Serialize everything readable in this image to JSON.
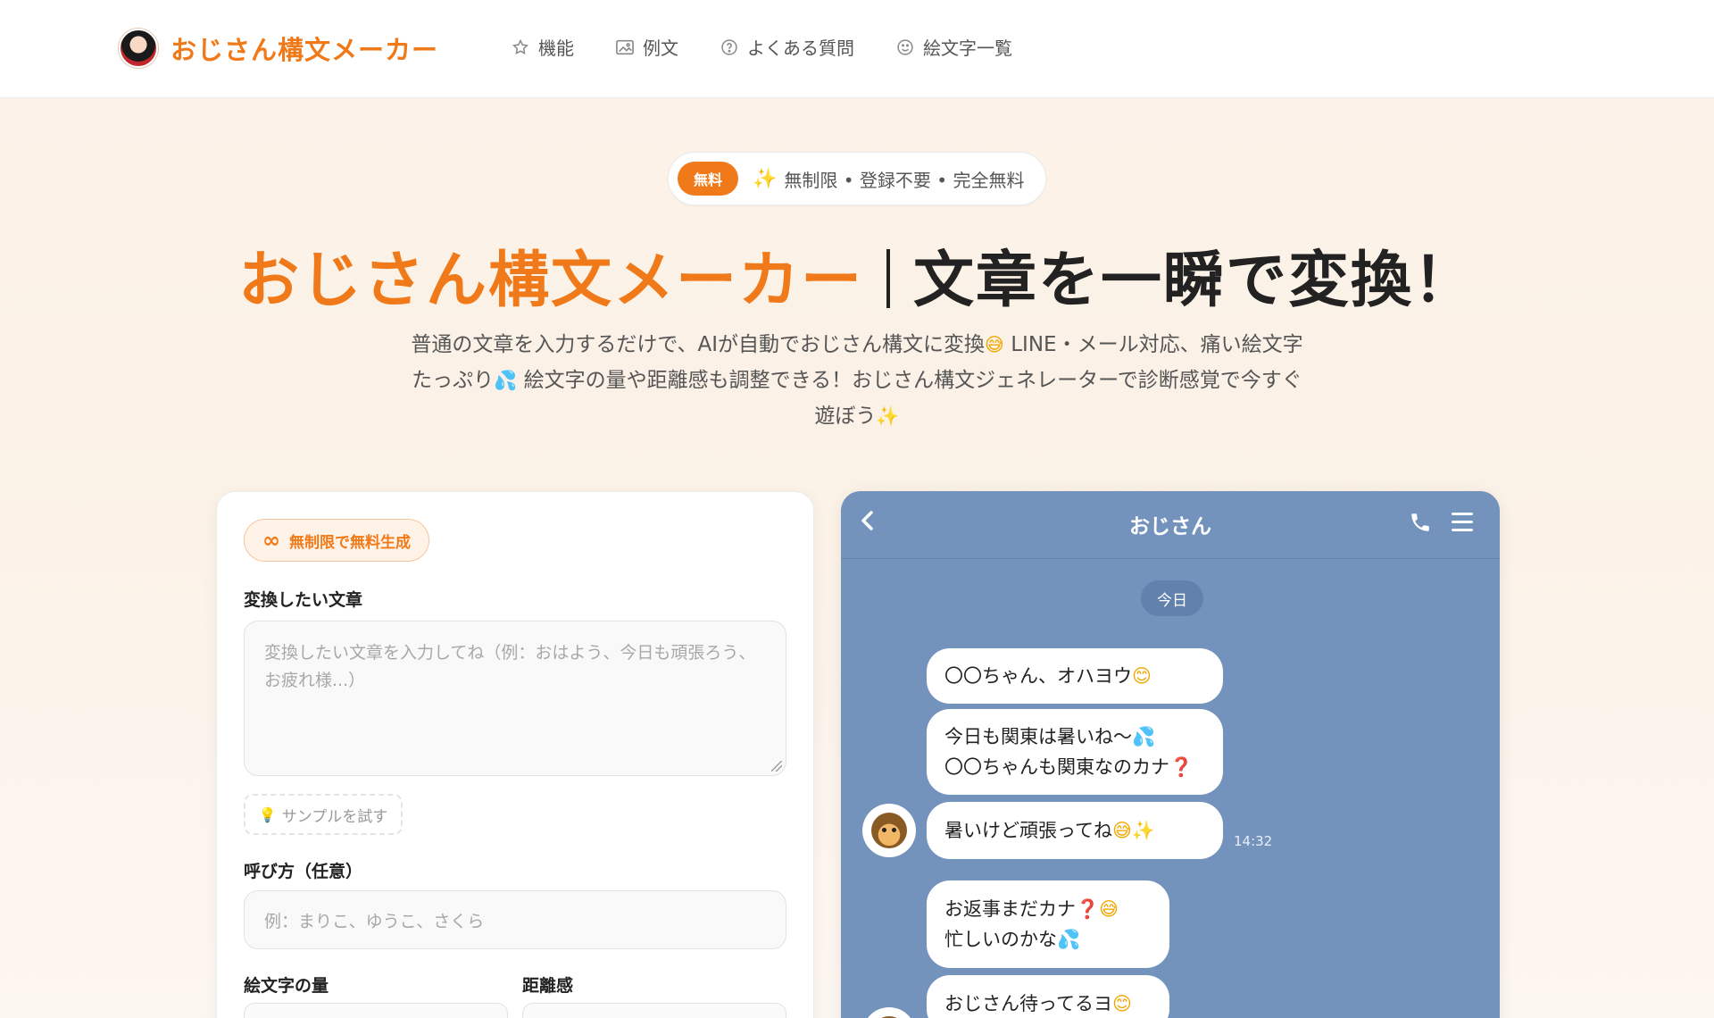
{
  "header": {
    "logo_text": "おじさん構文メーカー",
    "nav": [
      {
        "label": "機能",
        "icon": "star-icon"
      },
      {
        "label": "例文",
        "icon": "image-icon"
      },
      {
        "label": "よくある質問",
        "icon": "question-circle-icon"
      },
      {
        "label": "絵文字一覧",
        "icon": "smile-icon"
      }
    ]
  },
  "hero": {
    "pill_badge": "無料",
    "pill_text": "無制限 • 登録不要 • 完全無料",
    "title_orange": "おじさん構文メーカー",
    "title_dark": "文章を一瞬で変換！",
    "lead_1": "普通の文章を入力するだけで、AIが自動でおじさん構文に変換",
    "lead_2": " LINE・メール対応、痛い絵文字たっぷり",
    "lead_3": " 絵文字の量や距離感も調整できる！おじさん構文ジェネレーターで診断感覚で今すぐ遊ぼう"
  },
  "form": {
    "unlimited_badge": "無制限で無料生成",
    "text_label": "変換したい文章",
    "text_placeholder": "変換したい文章を入力してね（例：おはよう、今日も頑張ろう、お疲れ様...）",
    "sample_button": "サンプルを試す",
    "name_label": "呼び方（任意）",
    "name_placeholder": "例：まりこ、ゆうこ、さくら",
    "emoji_amount_label": "絵文字の量",
    "distance_label": "距離感"
  },
  "chat": {
    "title": "おじさん",
    "date_chip": "今日",
    "messages": [
      {
        "line1": "〇〇ちゃん、オハヨウ",
        "emoji1": "smile"
      },
      {
        "line1": "今日も関東は暑いね〜",
        "line2": "〇〇ちゃんも関東なのカナ"
      },
      {
        "line1": "暑いけど頑張ってね"
      },
      {
        "line1": "お返事まだカナ",
        "line2": "忙しいのかな"
      },
      {
        "line1": "おじさん待ってるヨ"
      }
    ],
    "time": "14:32"
  },
  "colors": {
    "accent": "#f07a1a",
    "chat_bg": "#7393bd",
    "page_bg": "#fcf3ea"
  }
}
